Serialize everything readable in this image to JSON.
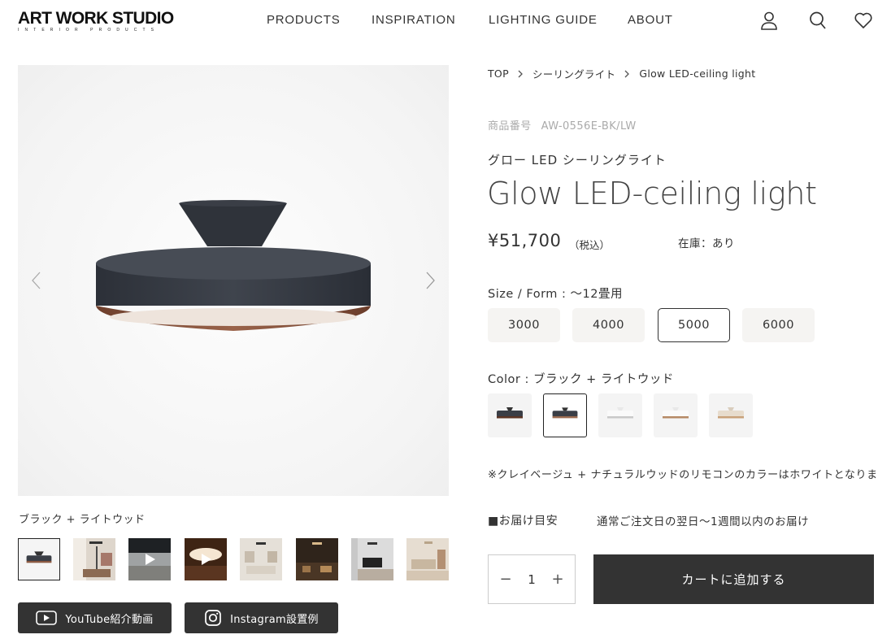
{
  "header": {
    "logo_main": "ART WORK STUDIO",
    "logo_sub": "INTERIOR PRODUCTS",
    "nav": [
      "PRODUCTS",
      "INSPIRATION",
      "LIGHTING GUIDE",
      "ABOUT"
    ],
    "icons": [
      "user-icon",
      "search-icon",
      "heart-icon"
    ]
  },
  "gallery": {
    "caption": "ブラック + ライトウッド",
    "thumbs": [
      "product",
      "room-lamp",
      "video-dark",
      "video-lit",
      "room-bright",
      "room-dark",
      "living-room",
      "living-beige"
    ],
    "buttons": {
      "youtube": "YouTube紹介動画",
      "instagram": "Instagram設置例"
    }
  },
  "breadcrumb": [
    "TOP",
    "シーリングライト",
    "Glow LED-ceiling light"
  ],
  "product": {
    "sku_label": "商品番号",
    "sku": "AW-0556E-BK/LW",
    "name_jp": "グロー LED シーリングライト",
    "name_en": "Glow LED-ceiling light",
    "price": "¥51,700",
    "tax": "（税込）",
    "stock": "在庫：あり"
  },
  "size": {
    "label": "Size / Form : 〜12畳用",
    "options": [
      "3000",
      "4000",
      "5000",
      "6000"
    ],
    "selected": "5000"
  },
  "color": {
    "label": "Color : ブラック + ライトウッド",
    "swatches": [
      "black-walnut",
      "black-lightwood",
      "white-gray",
      "white-wood",
      "beige-natural"
    ],
    "selected": "black-lightwood"
  },
  "note": "※クレイベージュ + ナチュラルウッドのリモコンのカラーはホワイトとなります",
  "delivery": {
    "label": "■お届け目安",
    "value": "通常ご注文日の翌日〜1週間以内のお届け"
  },
  "cart": {
    "qty_minus": "−",
    "quantity": "1",
    "qty_plus": "+",
    "add_label": "カートに追加する"
  }
}
